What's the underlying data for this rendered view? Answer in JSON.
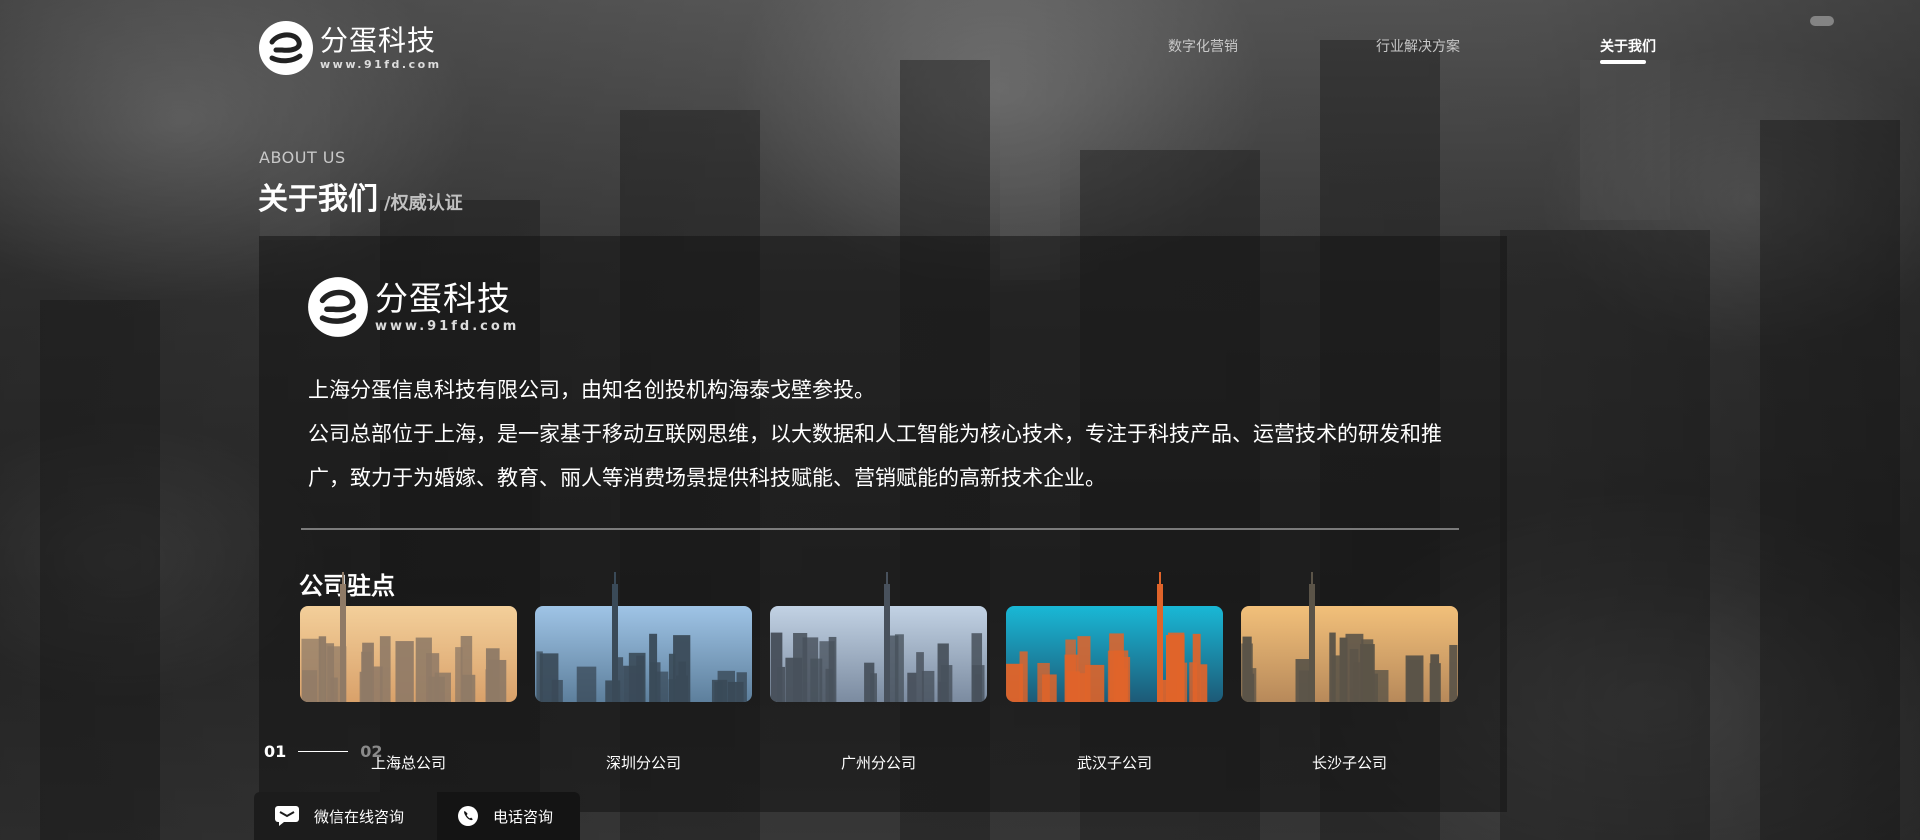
{
  "brand": {
    "name": "分蛋科技",
    "url": "www.91fd.com"
  },
  "nav": {
    "items": [
      {
        "label": "数字化营销",
        "active": false
      },
      {
        "label": "行业解决方案",
        "active": false
      },
      {
        "label": "关于我们",
        "active": true
      }
    ]
  },
  "section": {
    "eyebrow": "ABOUT US",
    "title": "关于我们",
    "subtitle": "/权威认证"
  },
  "about": {
    "paragraphs": [
      "上海分蛋信息科技有限公司，由知名创投机构海泰戈壁参投。",
      "公司总部位于上海，是一家基于移动互联网思维，以大数据和人工智能为核心技术，专注于科技产品、运营技术的研发和推广，致力于为婚嫁、教育、丽人等消费场景提供科技赋能、营销赋能的高新技术企业。"
    ],
    "offices_title": "公司驻点",
    "offices": [
      {
        "name": "上海总公司",
        "palette": [
          "#f3cf9a",
          "#d9a16a",
          "#8f7a66"
        ]
      },
      {
        "name": "深圳分公司",
        "palette": [
          "#9fc4e6",
          "#5d7f9c",
          "#3a4a58"
        ]
      },
      {
        "name": "广州分公司",
        "palette": [
          "#c2d2e4",
          "#7b8ba0",
          "#48515c"
        ]
      },
      {
        "name": "武汉子公司",
        "palette": [
          "#19b8d6",
          "#1d5a77",
          "#e0642a"
        ]
      },
      {
        "name": "长沙子公司",
        "palette": [
          "#f2c07a",
          "#b7895a",
          "#5b5448"
        ]
      }
    ]
  },
  "pager": {
    "current": "01",
    "next": "02"
  },
  "contact": {
    "wechat_label": "微信在线咨询",
    "phone_label": "电话咨询"
  }
}
